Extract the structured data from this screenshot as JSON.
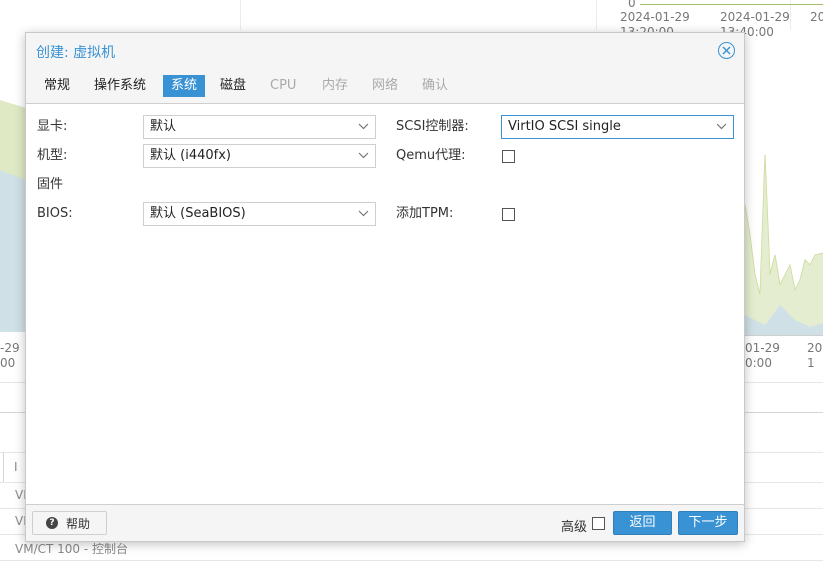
{
  "background": {
    "top_axis": [
      {
        "date": "2024-01-29",
        "time": "13:20:00"
      },
      {
        "date": "2024-01-29",
        "time": "13:40:00"
      },
      {
        "date": "20",
        "time": ""
      }
    ],
    "top_zero": "0",
    "mid_axis_left": {
      "date": "-29",
      "time": "00"
    },
    "mid_axis_right": [
      {
        "date": "01-29",
        "time": "0:00"
      },
      {
        "date": "20",
        "time": "1"
      }
    ],
    "list_rows": [
      "VM",
      "VM",
      "VM/CT 100 - 控制台"
    ],
    "list_col_header": "I"
  },
  "dialog": {
    "title": "创建: 虚拟机",
    "close_icon": "close-circle-icon",
    "tabs": [
      {
        "label": "常规",
        "state": "normal"
      },
      {
        "label": "操作系统",
        "state": "normal"
      },
      {
        "label": "系统",
        "state": "active"
      },
      {
        "label": "磁盘",
        "state": "normal"
      },
      {
        "label": "CPU",
        "state": "disabled"
      },
      {
        "label": "内存",
        "state": "disabled"
      },
      {
        "label": "网络",
        "state": "disabled"
      },
      {
        "label": "确认",
        "state": "disabled"
      }
    ],
    "form": {
      "graphics_label": "显卡:",
      "graphics_value": "默认",
      "machine_label": "机型:",
      "machine_value": "默认 (i440fx)",
      "firmware_heading": "固件",
      "bios_label": "BIOS:",
      "bios_value": "默认 (SeaBIOS)",
      "scsi_label": "SCSI控制器:",
      "scsi_value": "VirtIO SCSI single",
      "qemu_agent_label": "Qemu代理:",
      "qemu_agent_checked": false,
      "tpm_label": "添加TPM:",
      "tpm_checked": false
    },
    "footer": {
      "help_label": "帮助",
      "advanced_label": "高级",
      "advanced_checked": false,
      "back_label": "返回",
      "next_label": "下一步"
    }
  },
  "colors": {
    "accent": "#3892d4",
    "chart_fill_green": "#dfe9c4",
    "chart_fill_blue": "#cfe1e6"
  }
}
